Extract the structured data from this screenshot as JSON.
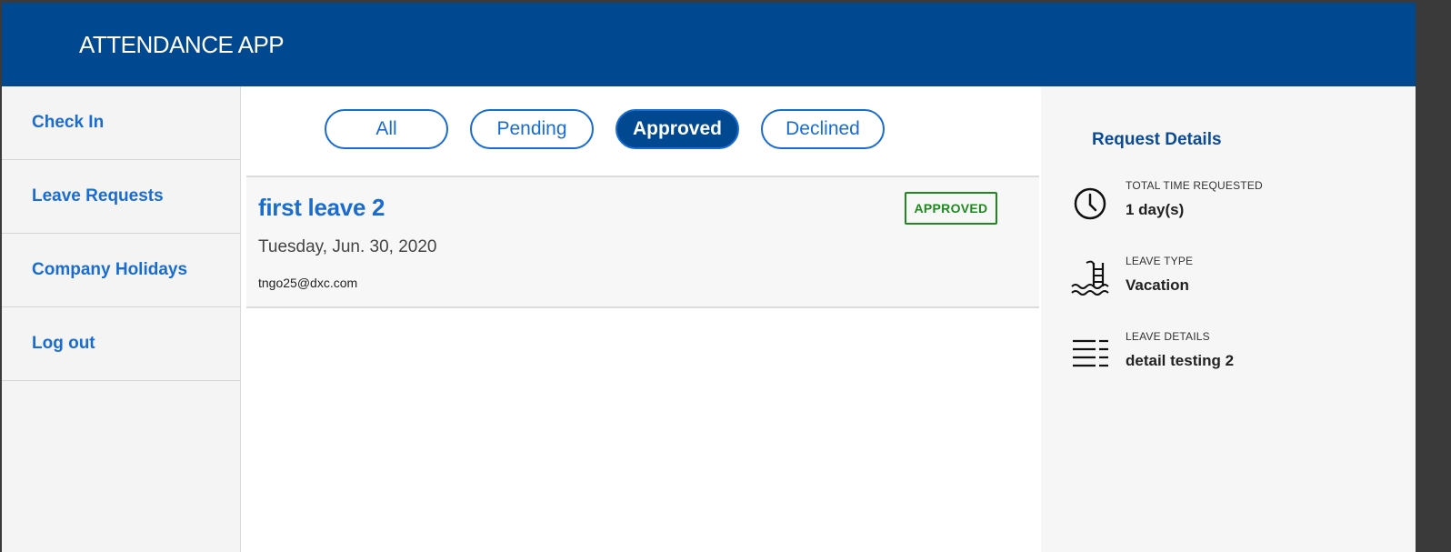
{
  "header": {
    "app_title": "ATTENDANCE APP"
  },
  "sidebar": {
    "items": [
      {
        "label": "Check In"
      },
      {
        "label": "Leave Requests"
      },
      {
        "label": "Company Holidays"
      },
      {
        "label": "Log out"
      }
    ]
  },
  "filters": {
    "all": "All",
    "pending": "Pending",
    "approved": "Approved",
    "declined": "Declined",
    "active": "Approved"
  },
  "request": {
    "title": "first leave 2",
    "date": "Tuesday, Jun. 30, 2020",
    "email": "tngo25@dxc.com",
    "status": "APPROVED"
  },
  "details": {
    "title": "Request Details",
    "total_time_label": "TOTAL TIME REQUESTED",
    "total_time_value": "1 day(s)",
    "leave_type_label": "LEAVE TYPE",
    "leave_type_value": "Vacation",
    "leave_details_label": "LEAVE DETAILS",
    "leave_details_value": "detail testing 2"
  },
  "colors": {
    "header_bg": "#004890",
    "link": "#1a6ccf",
    "approved": "#1e8a1e"
  },
  "icons": {
    "total_time": "clock-icon",
    "leave_type": "pool-ladder-icon",
    "leave_details": "list-lines-icon"
  }
}
